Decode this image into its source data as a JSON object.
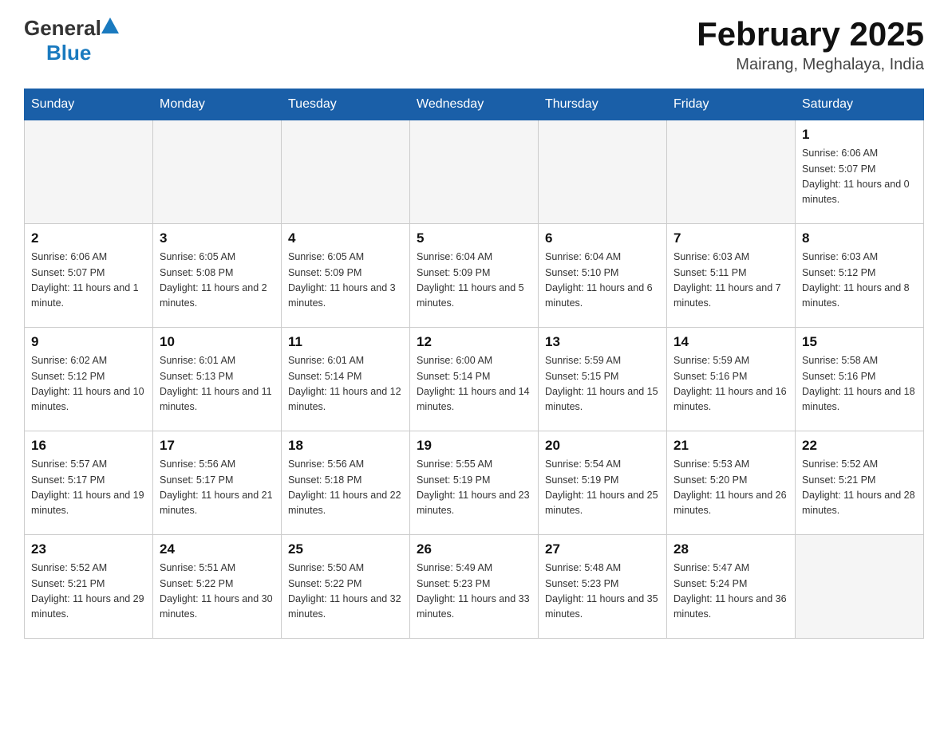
{
  "header": {
    "month_title": "February 2025",
    "location": "Mairang, Meghalaya, India",
    "logo_general": "General",
    "logo_blue": "Blue"
  },
  "weekdays": [
    "Sunday",
    "Monday",
    "Tuesday",
    "Wednesday",
    "Thursday",
    "Friday",
    "Saturday"
  ],
  "weeks": [
    [
      {
        "day": "",
        "empty": true
      },
      {
        "day": "",
        "empty": true
      },
      {
        "day": "",
        "empty": true
      },
      {
        "day": "",
        "empty": true
      },
      {
        "day": "",
        "empty": true
      },
      {
        "day": "",
        "empty": true
      },
      {
        "day": "1",
        "sunrise": "Sunrise: 6:06 AM",
        "sunset": "Sunset: 5:07 PM",
        "daylight": "Daylight: 11 hours and 0 minutes."
      }
    ],
    [
      {
        "day": "2",
        "sunrise": "Sunrise: 6:06 AM",
        "sunset": "Sunset: 5:07 PM",
        "daylight": "Daylight: 11 hours and 1 minute."
      },
      {
        "day": "3",
        "sunrise": "Sunrise: 6:05 AM",
        "sunset": "Sunset: 5:08 PM",
        "daylight": "Daylight: 11 hours and 2 minutes."
      },
      {
        "day": "4",
        "sunrise": "Sunrise: 6:05 AM",
        "sunset": "Sunset: 5:09 PM",
        "daylight": "Daylight: 11 hours and 3 minutes."
      },
      {
        "day": "5",
        "sunrise": "Sunrise: 6:04 AM",
        "sunset": "Sunset: 5:09 PM",
        "daylight": "Daylight: 11 hours and 5 minutes."
      },
      {
        "day": "6",
        "sunrise": "Sunrise: 6:04 AM",
        "sunset": "Sunset: 5:10 PM",
        "daylight": "Daylight: 11 hours and 6 minutes."
      },
      {
        "day": "7",
        "sunrise": "Sunrise: 6:03 AM",
        "sunset": "Sunset: 5:11 PM",
        "daylight": "Daylight: 11 hours and 7 minutes."
      },
      {
        "day": "8",
        "sunrise": "Sunrise: 6:03 AM",
        "sunset": "Sunset: 5:12 PM",
        "daylight": "Daylight: 11 hours and 8 minutes."
      }
    ],
    [
      {
        "day": "9",
        "sunrise": "Sunrise: 6:02 AM",
        "sunset": "Sunset: 5:12 PM",
        "daylight": "Daylight: 11 hours and 10 minutes."
      },
      {
        "day": "10",
        "sunrise": "Sunrise: 6:01 AM",
        "sunset": "Sunset: 5:13 PM",
        "daylight": "Daylight: 11 hours and 11 minutes."
      },
      {
        "day": "11",
        "sunrise": "Sunrise: 6:01 AM",
        "sunset": "Sunset: 5:14 PM",
        "daylight": "Daylight: 11 hours and 12 minutes."
      },
      {
        "day": "12",
        "sunrise": "Sunrise: 6:00 AM",
        "sunset": "Sunset: 5:14 PM",
        "daylight": "Daylight: 11 hours and 14 minutes."
      },
      {
        "day": "13",
        "sunrise": "Sunrise: 5:59 AM",
        "sunset": "Sunset: 5:15 PM",
        "daylight": "Daylight: 11 hours and 15 minutes."
      },
      {
        "day": "14",
        "sunrise": "Sunrise: 5:59 AM",
        "sunset": "Sunset: 5:16 PM",
        "daylight": "Daylight: 11 hours and 16 minutes."
      },
      {
        "day": "15",
        "sunrise": "Sunrise: 5:58 AM",
        "sunset": "Sunset: 5:16 PM",
        "daylight": "Daylight: 11 hours and 18 minutes."
      }
    ],
    [
      {
        "day": "16",
        "sunrise": "Sunrise: 5:57 AM",
        "sunset": "Sunset: 5:17 PM",
        "daylight": "Daylight: 11 hours and 19 minutes."
      },
      {
        "day": "17",
        "sunrise": "Sunrise: 5:56 AM",
        "sunset": "Sunset: 5:17 PM",
        "daylight": "Daylight: 11 hours and 21 minutes."
      },
      {
        "day": "18",
        "sunrise": "Sunrise: 5:56 AM",
        "sunset": "Sunset: 5:18 PM",
        "daylight": "Daylight: 11 hours and 22 minutes."
      },
      {
        "day": "19",
        "sunrise": "Sunrise: 5:55 AM",
        "sunset": "Sunset: 5:19 PM",
        "daylight": "Daylight: 11 hours and 23 minutes."
      },
      {
        "day": "20",
        "sunrise": "Sunrise: 5:54 AM",
        "sunset": "Sunset: 5:19 PM",
        "daylight": "Daylight: 11 hours and 25 minutes."
      },
      {
        "day": "21",
        "sunrise": "Sunrise: 5:53 AM",
        "sunset": "Sunset: 5:20 PM",
        "daylight": "Daylight: 11 hours and 26 minutes."
      },
      {
        "day": "22",
        "sunrise": "Sunrise: 5:52 AM",
        "sunset": "Sunset: 5:21 PM",
        "daylight": "Daylight: 11 hours and 28 minutes."
      }
    ],
    [
      {
        "day": "23",
        "sunrise": "Sunrise: 5:52 AM",
        "sunset": "Sunset: 5:21 PM",
        "daylight": "Daylight: 11 hours and 29 minutes."
      },
      {
        "day": "24",
        "sunrise": "Sunrise: 5:51 AM",
        "sunset": "Sunset: 5:22 PM",
        "daylight": "Daylight: 11 hours and 30 minutes."
      },
      {
        "day": "25",
        "sunrise": "Sunrise: 5:50 AM",
        "sunset": "Sunset: 5:22 PM",
        "daylight": "Daylight: 11 hours and 32 minutes."
      },
      {
        "day": "26",
        "sunrise": "Sunrise: 5:49 AM",
        "sunset": "Sunset: 5:23 PM",
        "daylight": "Daylight: 11 hours and 33 minutes."
      },
      {
        "day": "27",
        "sunrise": "Sunrise: 5:48 AM",
        "sunset": "Sunset: 5:23 PM",
        "daylight": "Daylight: 11 hours and 35 minutes."
      },
      {
        "day": "28",
        "sunrise": "Sunrise: 5:47 AM",
        "sunset": "Sunset: 5:24 PM",
        "daylight": "Daylight: 11 hours and 36 minutes."
      },
      {
        "day": "",
        "empty": true
      }
    ]
  ]
}
